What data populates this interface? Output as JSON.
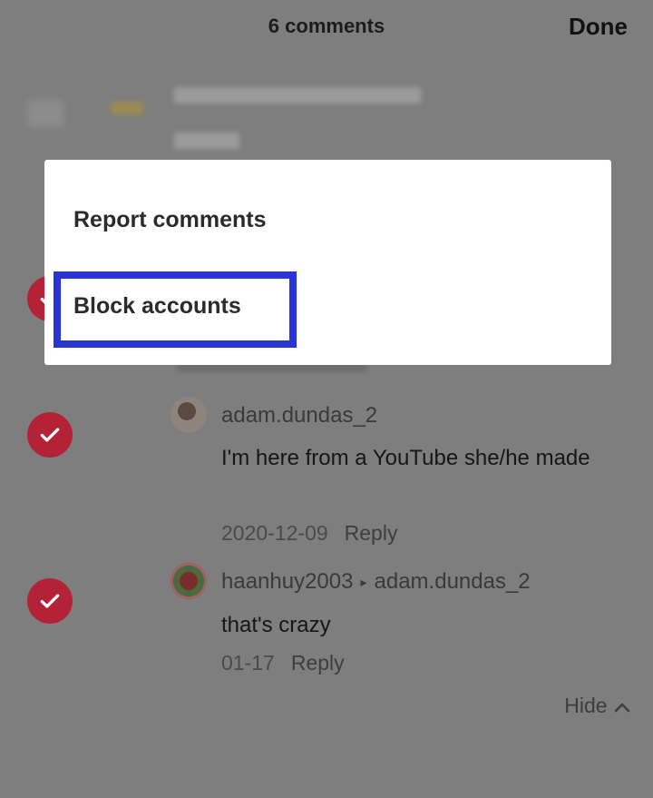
{
  "header": {
    "title": "6 comments",
    "done_label": "Done"
  },
  "popup": {
    "items": [
      {
        "label": "Report comments"
      },
      {
        "label": "Block accounts"
      }
    ]
  },
  "comments": [
    {
      "username": "adam.dundas_2",
      "text": "I'm here from a YouTube she/he made",
      "date": "2020-12-09",
      "reply_label": "Reply",
      "checked": true
    },
    {
      "username": "haanhuy2003",
      "reply_to": "adam.dundas_2",
      "text": "that's crazy",
      "date": "01-17",
      "reply_label": "Reply",
      "checked": true
    }
  ],
  "hide_label": "Hide",
  "colors": {
    "check": "#b42238",
    "highlight": "#2a33d8"
  }
}
